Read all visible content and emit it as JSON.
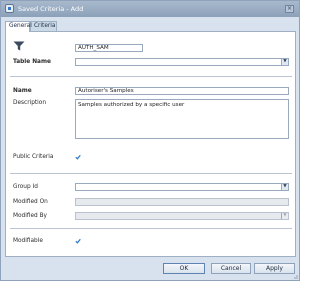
{
  "window": {
    "title": "Saved Criteria - Add",
    "close_glyph": "×"
  },
  "tabs": [
    {
      "label": "General",
      "active": true
    },
    {
      "label": "Criteria",
      "active": false
    }
  ],
  "form": {
    "icon": "filter-icon",
    "criteria_code": "AUTH_SAM",
    "table_name_label": "Table Name",
    "table_name_value": "",
    "name_label": "Name",
    "name_value": "Autoriser's Samples",
    "description_label": "Description",
    "description_value": "Samples authorized by a specific user",
    "public_criteria_label": "Public Criteria",
    "public_criteria_checked": true,
    "group_id_label": "Group Id",
    "group_id_value": "",
    "modified_on_label": "Modified On",
    "modified_on_value": "",
    "modified_by_label": "Modified By",
    "modified_by_value": "",
    "modifiable_label": "Modifiable",
    "modifiable_checked": true,
    "dropdown_glyph": "▼"
  },
  "buttons": {
    "ok": "OK",
    "cancel": "Cancel",
    "apply": "Apply"
  },
  "colors": {
    "titlebar": "#8ca1b9",
    "window_bg": "#d7e2ee",
    "accent": "#2f78c9"
  }
}
